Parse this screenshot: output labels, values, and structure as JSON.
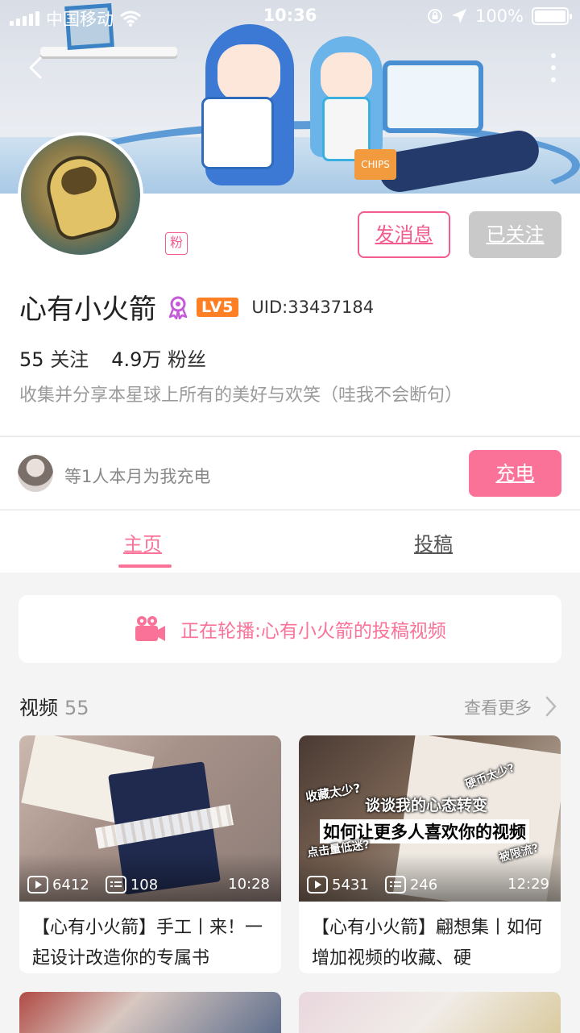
{
  "status_bar": {
    "carrier": "中国移动",
    "time": "10:36",
    "battery": "100%",
    "battery_level": 1.0
  },
  "header": {
    "back_icon": "back-arrow-icon",
    "more_icon": "more-vertical-icon"
  },
  "profile": {
    "fan_badge": "粉",
    "message_button": "发消息",
    "follow_button": "已关注",
    "username": "心有小火箭",
    "level": "LV5",
    "uid": "UID:33437184",
    "following_count": "55",
    "following_label": "关注",
    "followers_count": "4.9万",
    "followers_label": "粉丝",
    "bio": "收集并分享本星球上所有的美好与欢笑（哇我不会断句）"
  },
  "charge": {
    "text": "等1人本月为我充电",
    "button": "充电"
  },
  "tabs": {
    "home": "主页",
    "posts": "投稿"
  },
  "carousel": {
    "text": "正在轮播:心有小火箭的投稿视频"
  },
  "videos_section": {
    "title": "视频",
    "count": "55",
    "see_more": "查看更多",
    "items": [
      {
        "plays": "6412",
        "danmaku": "108",
        "duration": "10:28",
        "title": "【心有小火箭】手工丨来！一起设计改造你的专属书"
      },
      {
        "plays": "5431",
        "danmaku": "246",
        "duration": "12:29",
        "title": "【心有小火箭】翩想集丨如何增加视频的收藏、硬",
        "thumb_text": {
          "a": "收藏太少?",
          "b": "谈谈我的心态转变",
          "c": "如何让更多人喜欢你的视频",
          "d": "硬币太少?",
          "e": "点击量低迷?",
          "f": "被限流?"
        }
      }
    ]
  },
  "colors": {
    "accent": "#fb7299",
    "level_badge": "#ff7f24",
    "followed_gray": "#c9c9c9"
  }
}
